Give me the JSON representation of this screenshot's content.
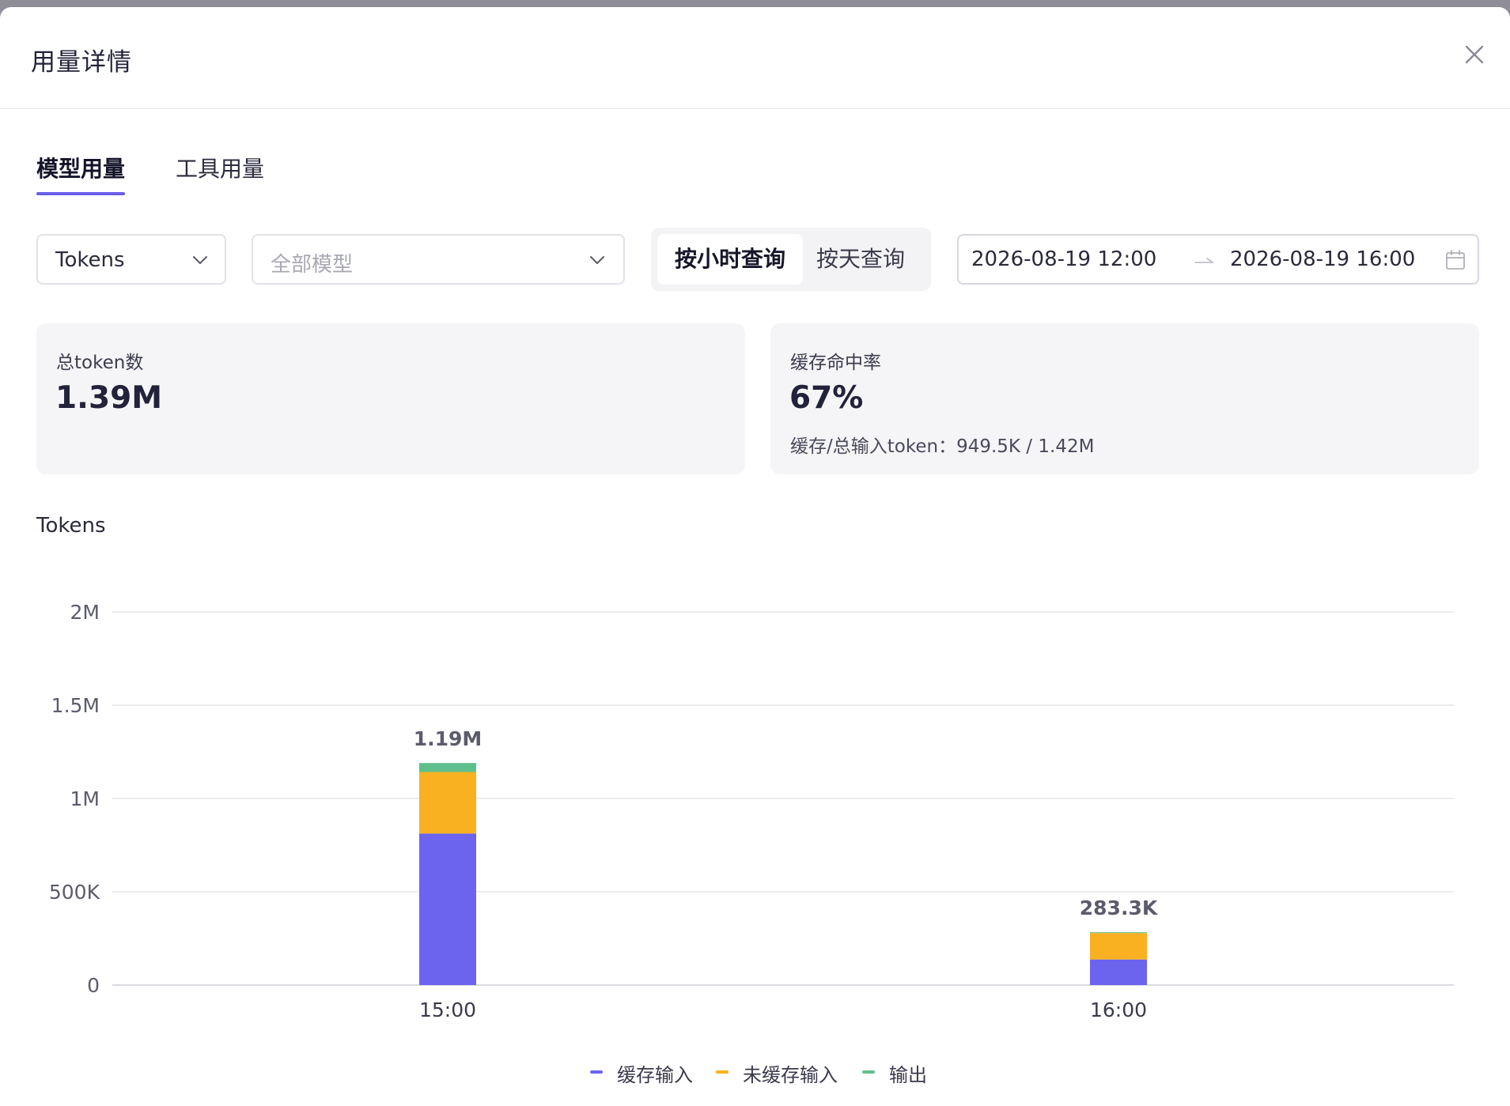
{
  "modal": {
    "title": "用量详情"
  },
  "tabs": [
    {
      "label": "模型用量",
      "active": true
    },
    {
      "label": "工具用量",
      "active": false
    }
  ],
  "filters": {
    "metric_value": "Tokens",
    "model_placeholder": "全部模型",
    "granularity": [
      {
        "label": "按小时查询",
        "active": true
      },
      {
        "label": "按天查询",
        "active": false
      }
    ],
    "date_start": "2026-08-19 12:00",
    "date_end": "2026-08-19 16:00"
  },
  "summary": {
    "total": {
      "label": "总token数",
      "value": "1.39M"
    },
    "cache": {
      "label": "缓存命中率",
      "value": "67%",
      "detail": "缓存/总输入token：949.5K / 1.42M"
    }
  },
  "colors": {
    "accent": "#6a5ee8",
    "cached_input": "#6c63ee",
    "uncached_input": "#f9b122",
    "output": "#5ec08d"
  },
  "chart_data": {
    "type": "bar",
    "stacked": true,
    "title": "",
    "ylabel": "Tokens",
    "xlabel": "",
    "categories": [
      "15:00",
      "16:00"
    ],
    "series": [
      {
        "name": "缓存输入",
        "values": [
          812000,
          137000
        ]
      },
      {
        "name": "未缓存输入",
        "values": [
          330000,
          142000
        ]
      },
      {
        "name": "输出",
        "values": [
          48000,
          4300
        ]
      }
    ],
    "totals_labels": [
      "1.19M",
      "283.3K"
    ],
    "ylim": [
      0,
      2000000
    ],
    "yticks": [
      {
        "value": 0,
        "label": "0"
      },
      {
        "value": 500000,
        "label": "500K"
      },
      {
        "value": 1000000,
        "label": "1M"
      },
      {
        "value": 1500000,
        "label": "1.5M"
      },
      {
        "value": 2000000,
        "label": "2M"
      }
    ],
    "grid": true,
    "legend_position": "bottom-center"
  }
}
